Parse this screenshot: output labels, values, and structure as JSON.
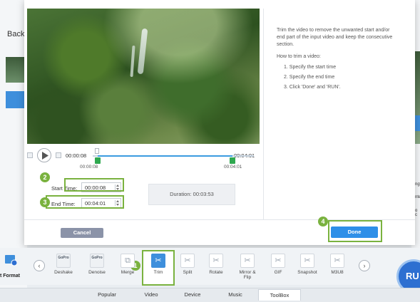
{
  "background": {
    "back_label": "Back",
    "right_text": [
      "ngt",
      "nte",
      "o c"
    ]
  },
  "player": {
    "current_time": "00:00:08",
    "total_time": "00:04:01",
    "start_marker": "00:00:08",
    "end_marker": "00:04:01",
    "trim_start_fraction": 0.033,
    "trim_end_fraction": 1.0
  },
  "trim": {
    "start_label": "Start Time:",
    "start_value": "00:00:08",
    "end_label": "End Time:",
    "end_value": "00:04:01",
    "duration_label": "Duration: 00:03:53"
  },
  "help": {
    "intro": "Trim the video to remove the unwanted start and/or end part of the input video and keep the consecutive section.",
    "intro_lines": [
      "Trim the video to remove the unwanted start and/or",
      "end part of the input video and keep the consecutive",
      "section."
    ],
    "howto_title": "How to trim a video:",
    "steps": [
      "1. Specify the start time",
      "2. Specify the end time",
      "3. Click 'Done' and 'RUN'."
    ]
  },
  "buttons": {
    "cancel": "Cancel",
    "done": "Done"
  },
  "callouts": [
    "1",
    "2",
    "3",
    "4"
  ],
  "toolbox": {
    "left_label": "t Format",
    "tools": [
      {
        "label": "Deshake",
        "icon": "gopro-icon",
        "badge": "GoPro"
      },
      {
        "label": "Denoise",
        "icon": "gopro-icon",
        "badge": "GoPro"
      },
      {
        "label": "Merge",
        "icon": "merge-icon"
      },
      {
        "label": "Trim",
        "icon": "trim-icon"
      },
      {
        "label": "Split",
        "icon": "split-icon"
      },
      {
        "label": "Rotate",
        "icon": "rotate-icon"
      },
      {
        "label": "Mirror &",
        "label2": "Flip",
        "icon": "mirror-icon"
      },
      {
        "label": "GIF",
        "icon": "gif-icon"
      },
      {
        "label": "Snapshot",
        "icon": "snapshot-icon"
      },
      {
        "label": "M3U8",
        "icon": "m3u8-icon"
      }
    ],
    "run_label": "RU"
  },
  "tabs": [
    "Popular",
    "Video",
    "Device",
    "Music",
    "ToolBox"
  ],
  "colors": {
    "accent": "#2e8fe8",
    "callout": "#7ab23f",
    "trim_handle": "#2fa84f"
  }
}
